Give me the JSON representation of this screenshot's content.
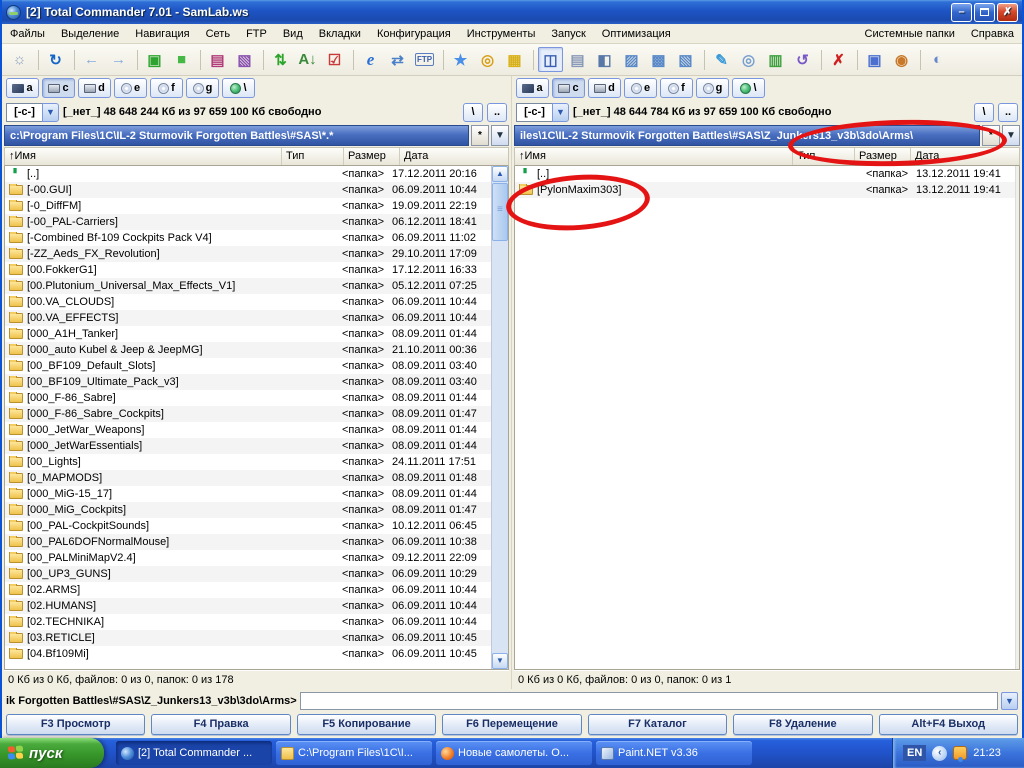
{
  "window": {
    "title": "[2] Total Commander 7.01 - SamLab.ws"
  },
  "titlebar_buttons": {
    "min": "–",
    "close": "✗"
  },
  "menu": {
    "left": [
      "Файлы",
      "Выделение",
      "Навигация",
      "Сеть",
      "FTP",
      "Вид",
      "Вкладки",
      "Конфигурация",
      "Инструменты",
      "Запуск",
      "Оптимизация"
    ],
    "right": [
      "Системные папки",
      "Справка"
    ]
  },
  "toolbar": {
    "icons": [
      {
        "name": "hint-icon",
        "glyph": "☼",
        "color": "#8aa0c0"
      },
      {
        "name": "refresh-icon",
        "glyph": "↻",
        "color": "#1565c8",
        "sep": true
      },
      {
        "name": "back-icon",
        "glyph": "←",
        "color": "#86abdd",
        "sep": true
      },
      {
        "name": "forward-icon",
        "glyph": "→",
        "color": "#86abdd"
      },
      {
        "name": "pack-files-icon",
        "glyph": "▣",
        "color": "#2fa32f",
        "sep": true
      },
      {
        "name": "unpack-files-icon",
        "glyph": "■",
        "color": "#46b846"
      },
      {
        "name": "rar-pack-icon",
        "glyph": "▤",
        "color": "#b03a78",
        "sep": true
      },
      {
        "name": "rar-extract-icon",
        "glyph": "▧",
        "color": "#8a52b0"
      },
      {
        "name": "vertical-sort-icon",
        "glyph": "⇅",
        "color": "#2ca52c",
        "sep": true
      },
      {
        "name": "sort-az-icon",
        "glyph": "A↓",
        "color": "#3a8a3a"
      },
      {
        "name": "verify-checklist-icon",
        "glyph": "☑",
        "color": "#c83a3a"
      },
      {
        "name": "internet-explorer-icon",
        "glyph": "e",
        "color": "#2a6fd8",
        "sep": true,
        "cls": "ie"
      },
      {
        "name": "map-network-drive-icon",
        "glyph": "⇄",
        "color": "#4a80c8"
      },
      {
        "name": "ftp-connect-icon",
        "glyph": "FTP",
        "color": "#3a5fb0",
        "cls": "tiny"
      },
      {
        "name": "favorites-star-icon",
        "glyph": "★",
        "color": "#4a90e8",
        "sep": true
      },
      {
        "name": "search-icon",
        "glyph": "◎",
        "color": "#d8a018"
      },
      {
        "name": "panel-calendar-icon",
        "glyph": "▦",
        "color": "#d8b018"
      },
      {
        "name": "view-brief-icon",
        "glyph": "◫",
        "color": "#3a5fb0",
        "sep": true,
        "pressed": true
      },
      {
        "name": "view-thumbnails-icon",
        "glyph": "▤",
        "color": "#8898b8"
      },
      {
        "name": "view-details-icon",
        "glyph": "◧",
        "color": "#5878a8"
      },
      {
        "name": "folder-open-icon",
        "glyph": "▨",
        "color": "#5888c8"
      },
      {
        "name": "folder-pictures-icon",
        "glyph": "▩",
        "color": "#5888c8"
      },
      {
        "name": "folder-search-icon",
        "glyph": "▧",
        "color": "#5888c8"
      },
      {
        "name": "multi-rename-tool-icon",
        "glyph": "✎",
        "color": "#3a9ad8",
        "sep": true
      },
      {
        "name": "search-files-icon",
        "glyph": "◎",
        "color": "#78a0d0"
      },
      {
        "name": "disk-usage-chart-icon",
        "glyph": "▥",
        "color": "#40a040"
      },
      {
        "name": "sync-dirs-icon",
        "glyph": "↺",
        "color": "#7858c8"
      },
      {
        "name": "delete-icon",
        "glyph": "✗",
        "color": "#d02020",
        "sep": true
      },
      {
        "name": "lock-screen-icon",
        "glyph": "▣",
        "color": "#4a6fd0",
        "sep": true
      },
      {
        "name": "burn-cd-icon",
        "glyph": "◉",
        "color": "#c87828"
      },
      {
        "name": "web-document-icon",
        "glyph": "◐",
        "color": "#6888c8",
        "sep": true
      }
    ]
  },
  "drives": {
    "buttons": [
      {
        "name": "drive-a-button",
        "letter": "a",
        "icon": "floppy"
      },
      {
        "name": "drive-c-button",
        "letter": "c",
        "icon": "hdd",
        "pressed": true
      },
      {
        "name": "drive-d-button",
        "letter": "d",
        "icon": "hdd"
      },
      {
        "name": "drive-e-button",
        "letter": "e",
        "icon": "cd"
      },
      {
        "name": "drive-f-button",
        "letter": "f",
        "icon": "cd"
      },
      {
        "name": "drive-g-button",
        "letter": "g",
        "icon": "cd"
      },
      {
        "name": "drive-net-button",
        "letter": "\\",
        "icon": "net"
      }
    ]
  },
  "headers": {
    "name": "↑Имя",
    "type": "Тип",
    "size": "Размер",
    "date": "Дата"
  },
  "path_buttons": {
    "star": "*",
    "dropdown": "▼"
  },
  "drive_info_buttons": {
    "root": "\\",
    "up": ".."
  },
  "panels": {
    "left": {
      "drive": "[-c-]",
      "info": "[_нет_]  48 648 244 Кб из 97 659 100 Кб свободно",
      "path": "c:\\Program Files\\1C\\IL-2 Sturmovik Forgotten Battles\\#SAS\\*.*",
      "status": "0 Кб из 0 Кб, файлов: 0 из 0, папок: 0 из 178",
      "files": [
        {
          "name": "[..]",
          "type": "<папка>",
          "date": "17.12.2011 20:16",
          "icon": "up"
        },
        {
          "name": "[-00.GUI]",
          "type": "<папка>",
          "date": "06.09.2011 10:44",
          "icon": "folder"
        },
        {
          "name": "[-0_DiffFM]",
          "type": "<папка>",
          "date": "19.09.2011 22:19",
          "icon": "folder"
        },
        {
          "name": "[-00_PAL-Carriers]",
          "type": "<папка>",
          "date": "06.12.2011 18:41",
          "icon": "folder"
        },
        {
          "name": "[-Combined Bf-109 Cockpits Pack V4]",
          "type": "<папка>",
          "date": "06.09.2011 11:02",
          "icon": "folder"
        },
        {
          "name": "[-ZZ_Aeds_FX_Revolution]",
          "type": "<папка>",
          "date": "29.10.2011 17:09",
          "icon": "folder"
        },
        {
          "name": "[00.FokkerG1]",
          "type": "<папка>",
          "date": "17.12.2011 16:33",
          "icon": "folder"
        },
        {
          "name": "[00.Plutonium_Universal_Max_Effects_V1]",
          "type": "<папка>",
          "date": "05.12.2011 07:25",
          "icon": "folder"
        },
        {
          "name": "[00.VA_CLOUDS]",
          "type": "<папка>",
          "date": "06.09.2011 10:44",
          "icon": "folder"
        },
        {
          "name": "[00.VA_EFFECTS]",
          "type": "<папка>",
          "date": "06.09.2011 10:44",
          "icon": "folder"
        },
        {
          "name": "[000_A1H_Tanker]",
          "type": "<папка>",
          "date": "08.09.2011 01:44",
          "icon": "folder"
        },
        {
          "name": "[000_auto Kubel & Jeep &  JeepMG]",
          "type": "<папка>",
          "date": "21.10.2011 00:36",
          "icon": "folder"
        },
        {
          "name": "[00_BF109_Default_Slots]",
          "type": "<папка>",
          "date": "08.09.2011 03:40",
          "icon": "folder"
        },
        {
          "name": "[00_BF109_Ultimate_Pack_v3]",
          "type": "<папка>",
          "date": "08.09.2011 03:40",
          "icon": "folder"
        },
        {
          "name": "[000_F-86_Sabre]",
          "type": "<папка>",
          "date": "08.09.2011 01:44",
          "icon": "folder"
        },
        {
          "name": "[000_F-86_Sabre_Cockpits]",
          "type": "<папка>",
          "date": "08.09.2011 01:47",
          "icon": "folder"
        },
        {
          "name": "[000_JetWar_Weapons]",
          "type": "<папка>",
          "date": "08.09.2011 01:44",
          "icon": "folder"
        },
        {
          "name": "[000_JetWarEssentials]",
          "type": "<папка>",
          "date": "08.09.2011 01:44",
          "icon": "folder"
        },
        {
          "name": "[00_Lights]",
          "type": "<папка>",
          "date": "24.11.2011 17:51",
          "icon": "folder"
        },
        {
          "name": "[0_MAPMODS]",
          "type": "<папка>",
          "date": "08.09.2011 01:48",
          "icon": "folder"
        },
        {
          "name": "[000_MiG-15_17]",
          "type": "<папка>",
          "date": "08.09.2011 01:44",
          "icon": "folder"
        },
        {
          "name": "[000_MiG_Cockpits]",
          "type": "<папка>",
          "date": "08.09.2011 01:47",
          "icon": "folder"
        },
        {
          "name": "[00_PAL-CockpitSounds]",
          "type": "<папка>",
          "date": "10.12.2011 06:45",
          "icon": "folder"
        },
        {
          "name": "[00_PAL6DOFNormalMouse]",
          "type": "<папка>",
          "date": "06.09.2011 10:38",
          "icon": "folder"
        },
        {
          "name": "[00_PALMiniMapV2.4]",
          "type": "<папка>",
          "date": "09.12.2011 22:09",
          "icon": "folder"
        },
        {
          "name": "[00_UP3_GUNS]",
          "type": "<папка>",
          "date": "06.09.2011 10:29",
          "icon": "folder"
        },
        {
          "name": "[02.ARMS]",
          "type": "<папка>",
          "date": "06.09.2011 10:44",
          "icon": "folder"
        },
        {
          "name": "[02.HUMANS]",
          "type": "<папка>",
          "date": "06.09.2011 10:44",
          "icon": "folder"
        },
        {
          "name": "[02.TECHNIKA]",
          "type": "<папка>",
          "date": "06.09.2011 10:44",
          "icon": "folder"
        },
        {
          "name": "[03.RETICLE]",
          "type": "<папка>",
          "date": "06.09.2011 10:45",
          "icon": "folder"
        },
        {
          "name": "[04.Bf109Mi]",
          "type": "<папка>",
          "date": "06.09.2011 10:45",
          "icon": "folder"
        }
      ]
    },
    "right": {
      "drive": "[-c-]",
      "info": "[_нет_]  48 644 784 Кб из 97 659 100 Кб свободно",
      "path": "iles\\1C\\IL-2 Sturmovik Forgotten Battles\\#SAS\\Z_Junkers13_v3b\\3do\\Arms\\",
      "status": "0 Кб из 0 Кб, файлов: 0 из 0, папок: 0 из 1",
      "files": [
        {
          "name": "[..]",
          "type": "<папка>",
          "date": "13.12.2011 19:41",
          "icon": "up"
        },
        {
          "name": "[PylonMaxim303]",
          "type": "<папка>",
          "date": "13.12.2011 19:41",
          "icon": "folder"
        }
      ]
    }
  },
  "command": {
    "prompt": "ik Forgotten Battles\\#SAS\\Z_Junkers13_v3b\\3do\\Arms>"
  },
  "fkeys": [
    "F3 Просмотр",
    "F4 Правка",
    "F5 Копирование",
    "F6 Перемещение",
    "F7 Каталог",
    "F8 Удаление",
    "Alt+F4 Выход"
  ],
  "taskbar": {
    "start": "пуск",
    "tasks": [
      {
        "label": "[2] Total Commander ...",
        "cls": "task-tc",
        "active": true
      },
      {
        "label": "C:\\Program Files\\1C\\I...",
        "cls": "task-folder"
      },
      {
        "label": "Новые самолеты. О...",
        "cls": "task-ff"
      },
      {
        "label": "Paint.NET v3.36",
        "cls": "task-pdn"
      }
    ],
    "tray": {
      "lang": "EN",
      "time": "21:23"
    }
  }
}
